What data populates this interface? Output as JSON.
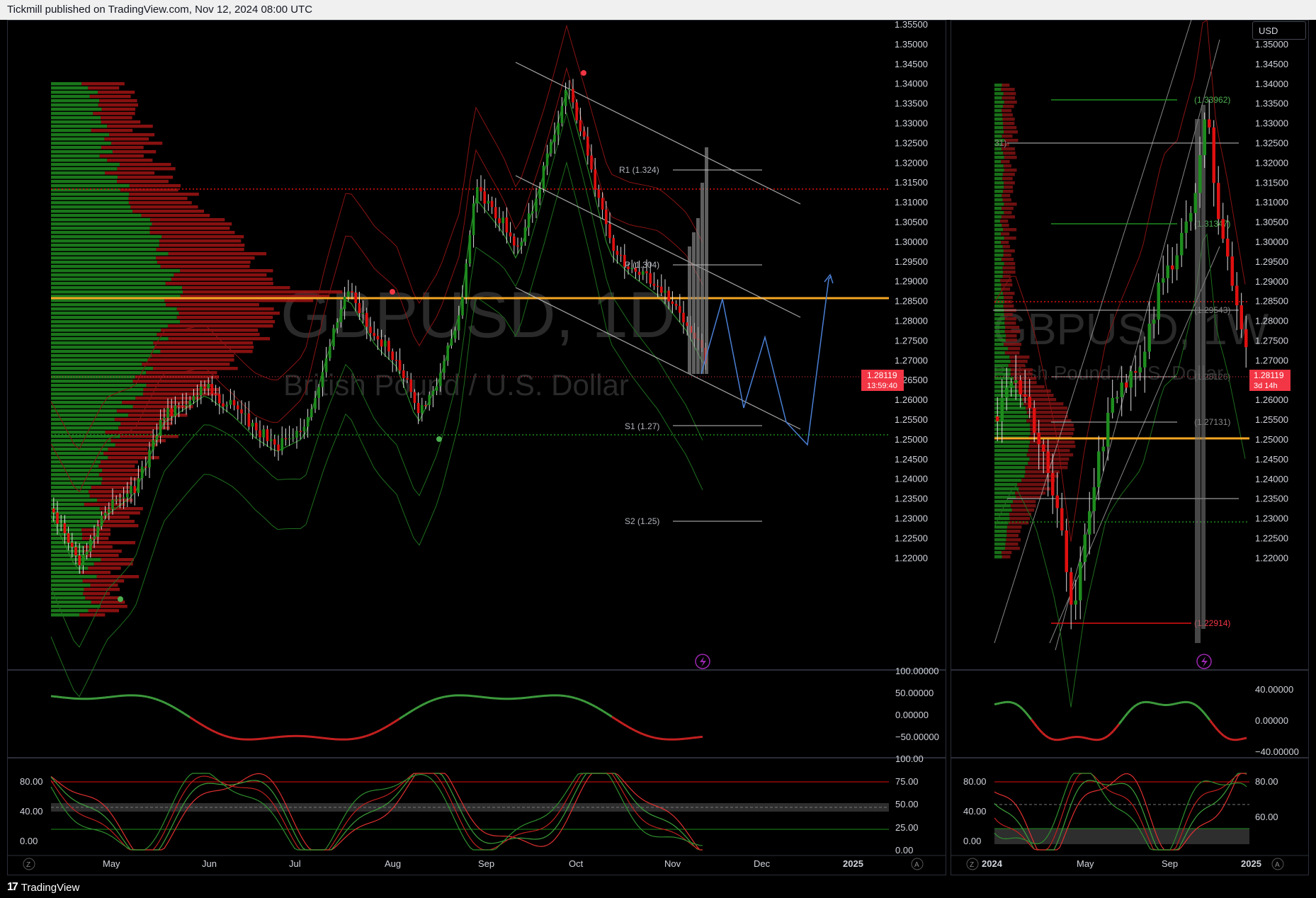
{
  "header": {
    "text": "Tickmill published on TradingView.com, Nov 12, 2024 08:00 UTC"
  },
  "footer": {
    "logo_glyph": "17",
    "brand": "TradingView"
  },
  "colors": {
    "up": "#1e8c1e",
    "down": "#e01010",
    "poc": "#f5a623",
    "price_tag": "#f23645",
    "projection": "#4a7fd4",
    "pivot": "#b0b3bb"
  },
  "left_chart": {
    "watermark_symbol": "GBPUSD, 1D",
    "watermark_desc": "British Pound / U.S. Dollar",
    "price_axis": [
      "1.35500",
      "1.35000",
      "1.34500",
      "1.34000",
      "1.33500",
      "1.33000",
      "1.32500",
      "1.32000",
      "1.31500",
      "1.31000",
      "1.30500",
      "1.30000",
      "1.29500",
      "1.29000",
      "1.28500",
      "1.28000",
      "1.27500",
      "1.27000",
      "1.26500",
      "1.26000",
      "1.25500",
      "1.25000",
      "1.24500",
      "1.24000",
      "1.23500",
      "1.23000",
      "1.22500",
      "1.22000"
    ],
    "price_tag": {
      "price": "1.28119",
      "countdown": "13:59:40"
    },
    "pivots": {
      "r1": "R1 (1.324)",
      "p": "P (1.304)",
      "s1": "S1 (1.27)",
      "s2": "S2 (1.25)"
    },
    "osc1_axis": [
      "100.00000",
      "50.00000",
      "0.00000",
      "−50.00000"
    ],
    "osc2_axis": [
      "100.00",
      "75.00",
      "50.00",
      "25.00",
      "0.00"
    ],
    "osc2_left_axis": [
      "80.00",
      "40.00",
      "0.00"
    ],
    "time_axis": [
      "May",
      "Jun",
      "Jul",
      "Aug",
      "Sep",
      "Oct",
      "Nov",
      "Dec",
      "2025"
    ],
    "corner_left": "Z",
    "corner_right": "A"
  },
  "right_chart": {
    "currency_button": "USD",
    "watermark_symbol": "GBPUSD, 1W",
    "watermark_desc": "British Pound / U.S. Dollar",
    "price_axis": [
      "1.35000",
      "1.34500",
      "1.34000",
      "1.33500",
      "1.33000",
      "1.32500",
      "1.32000",
      "1.31500",
      "1.31000",
      "1.30500",
      "1.30000",
      "1.29500",
      "1.29000",
      "1.28500",
      "1.28000",
      "1.27500",
      "1.27000",
      "1.26500",
      "1.26000",
      "1.25500",
      "1.25000",
      "1.24500",
      "1.24000",
      "1.23500",
      "1.23000",
      "1.22500",
      "1.22000"
    ],
    "price_tag": {
      "price": "1.28119",
      "countdown": "3d 14h"
    },
    "fib_labels": [
      "(1.33962)",
      "(1.31347)",
      "(1.29543)",
      "(1.28126)",
      "(1.27131)",
      "(1.22914)"
    ],
    "fib_cut_label": "31)",
    "osc1_axis": [
      "40.00000",
      "0.00000",
      "−40.00000"
    ],
    "osc2_axis": [
      "80.00",
      "60.00"
    ],
    "osc2_left_axis": [
      "80.00",
      "40.00",
      "0.00"
    ],
    "time_axis": [
      "2024",
      "May",
      "Sep",
      "2025"
    ],
    "corner_left": "Z",
    "corner_right": "A"
  }
}
